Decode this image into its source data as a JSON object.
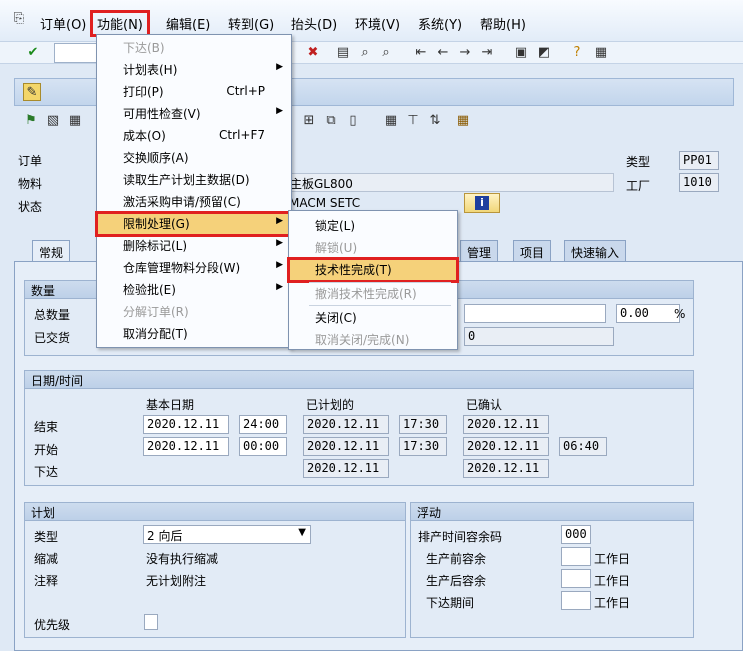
{
  "menubar": {
    "items": [
      "订单(O)",
      "功能(N)",
      "编辑(E)",
      "转到(G)",
      "抬头(D)",
      "环境(V)",
      "系统(Y)",
      "帮助(H)"
    ]
  },
  "header": {
    "order_label": "订单",
    "material_label": "物料",
    "status_label": "状态",
    "material_text": "主板GL800",
    "status_text": "MACM SETC",
    "type_label": "类型",
    "type_value": "PP01",
    "plant_label": "工厂",
    "plant_value": "1010"
  },
  "tabs": [
    "常规",
    "管理",
    "项目",
    "快速输入"
  ],
  "quantity": {
    "title": "数量",
    "total_label": "总数量",
    "delivered_label": "已交货",
    "percent_value": "0.00",
    "percent_unit": "%",
    "delivered_value": "0"
  },
  "dates": {
    "title": "日期/时间",
    "col_basic": "基本日期",
    "col_scheduled": "已计划的",
    "col_confirmed": "已确认",
    "row_end": "结束",
    "row_start": "开始",
    "row_release": "下达",
    "end_basic_date": "2020.12.11",
    "end_basic_time": "24:00",
    "end_sched_date": "2020.12.11",
    "end_sched_time": "17:30",
    "end_conf_date": "2020.12.11",
    "start_basic_date": "2020.12.11",
    "start_basic_time": "00:00",
    "start_sched_date": "2020.12.11",
    "start_sched_time": "17:30",
    "start_conf_date": "2020.12.11",
    "start_conf_time": "06:40",
    "release_sched_date": "2020.12.11",
    "release_conf_date": "2020.12.11"
  },
  "plan": {
    "title": "计划",
    "type_label": "类型",
    "type_value": "2 向后",
    "reduce_label": "缩减",
    "reduce_value": "没有执行缩减",
    "note_label": "注释",
    "note_value": "无计划附注",
    "priority_label": "优先级"
  },
  "float": {
    "title": "浮动",
    "sched_margin_label": "排产时间容余码",
    "sched_margin_value": "000",
    "pre_label": "生产前容余",
    "post_label": "生产后容余",
    "release_label": "下达期间",
    "unit": "工作日"
  },
  "function_menu": {
    "items": [
      {
        "label": "下达(B)",
        "disabled": true
      },
      {
        "label": "计划表(H)",
        "arrow": true
      },
      {
        "label": "打印(P)",
        "shortcut": "Ctrl+P"
      },
      {
        "label": "可用性检查(V)",
        "arrow": true
      },
      {
        "label": "成本(O)",
        "shortcut": "Ctrl+F7"
      },
      {
        "label": "交换顺序(A)"
      },
      {
        "label": "读取生产计划主数据(D)"
      },
      {
        "label": "激活采购申请/预留(C)"
      },
      {
        "label": "限制处理(G)",
        "arrow": true,
        "highlight": true
      },
      {
        "label": "删除标记(L)",
        "arrow": true
      },
      {
        "label": "仓库管理物料分段(W)",
        "arrow": true
      },
      {
        "label": "检验批(E)",
        "arrow": true
      },
      {
        "label": "分解订单(R)",
        "disabled": true
      },
      {
        "label": "取消分配(T)"
      }
    ]
  },
  "restrict_submenu": {
    "items": [
      {
        "label": "锁定(L)"
      },
      {
        "label": "解锁(U)",
        "disabled": true
      },
      {
        "label": "技术性完成(T)",
        "highlight": true
      },
      {
        "label": "撤消技术性完成(R)",
        "disabled": true
      },
      {
        "label": "关闭(C)"
      },
      {
        "label": "取消关闭/完成(N)",
        "disabled": true
      }
    ]
  },
  "colors": {
    "highlight": "#f5d17a",
    "annotation_red": "#e02020"
  }
}
